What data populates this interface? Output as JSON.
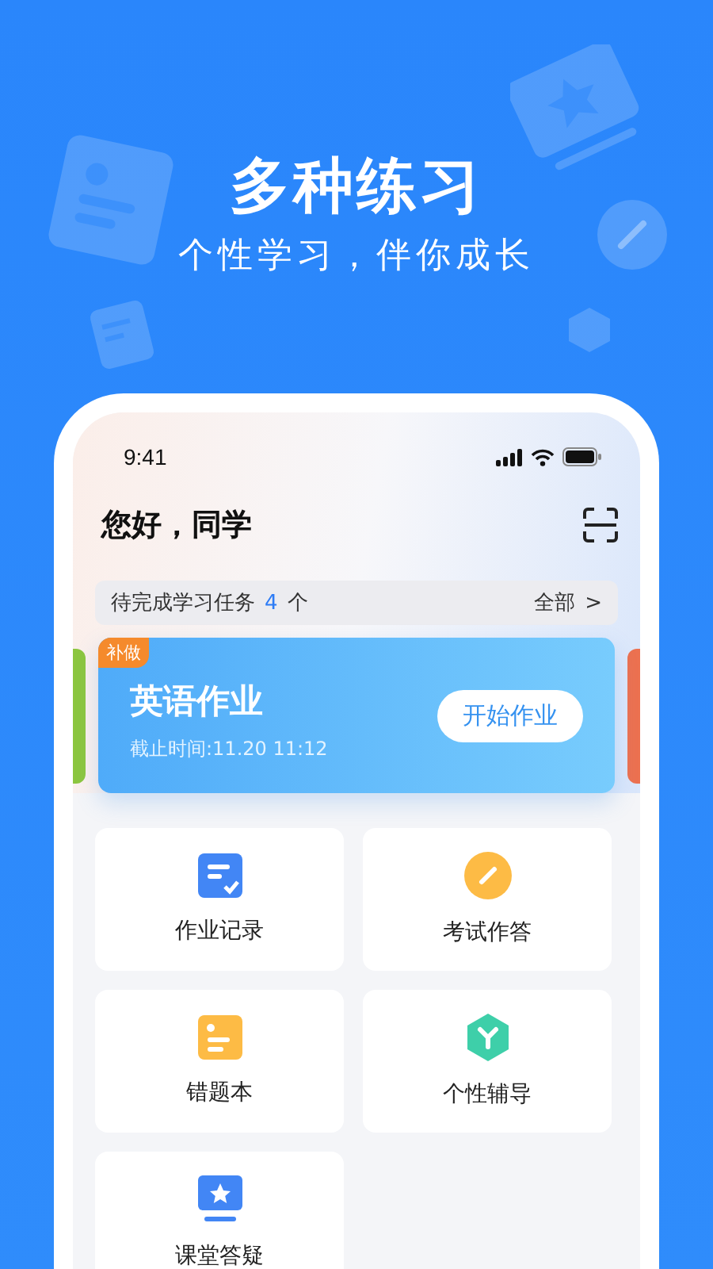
{
  "promo": {
    "title": "多种练习",
    "subtitle": "个性学习，伴你成长"
  },
  "status_bar": {
    "time": "9:41"
  },
  "greeting": "您好，同学",
  "tasks": {
    "label": "待完成学习任务",
    "count": "4",
    "unit": "个",
    "link": "全部",
    "chevron": ">"
  },
  "assignment": {
    "badge": "补做",
    "title": "英语作业",
    "deadline": "截止时间:11.20 11:12",
    "button": "开始作业"
  },
  "tiles": [
    {
      "kind": "record",
      "label": "作业记录"
    },
    {
      "kind": "exam",
      "label": "考试作答"
    },
    {
      "kind": "mistakes",
      "label": "错题本"
    },
    {
      "kind": "tutor",
      "label": "个性辅导"
    },
    {
      "kind": "qa",
      "label": "课堂答疑"
    }
  ]
}
